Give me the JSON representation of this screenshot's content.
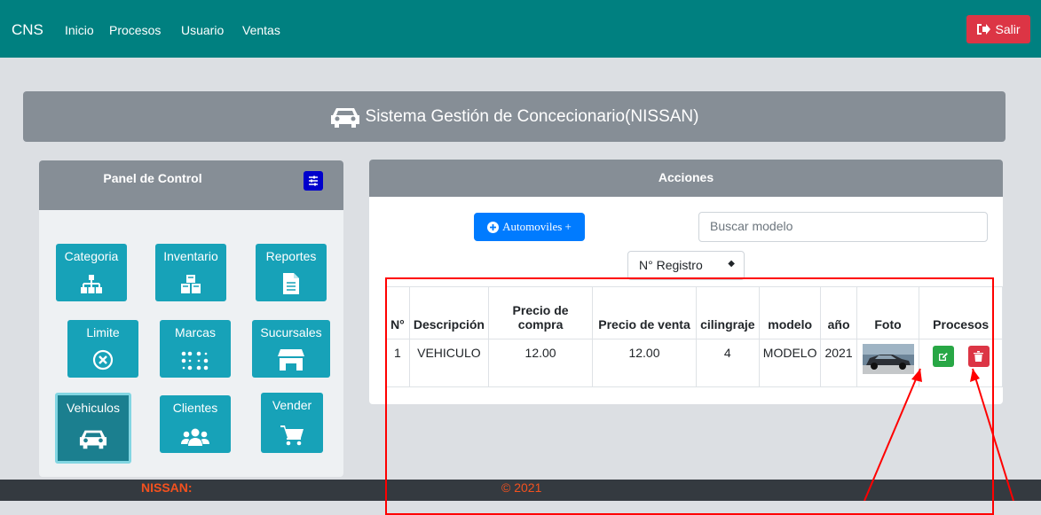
{
  "navbar": {
    "brand": "CNS",
    "links": [
      "Inicio",
      "Procesos",
      "Usuario",
      "Ventas"
    ],
    "logout": "Salir"
  },
  "banner": {
    "title": "Sistema Gestión de Concecionario(NISSAN)",
    "icon": "car-icon"
  },
  "control_panel": {
    "title": "Panel de Control",
    "tiles": [
      {
        "label": "Categoria",
        "icon": "sitemap-icon"
      },
      {
        "label": "Inventario",
        "icon": "cubes-icon"
      },
      {
        "label": "Reportes",
        "icon": "file-icon"
      },
      {
        "label": "Limite",
        "icon": "circle-x-icon"
      },
      {
        "label": "Marcas",
        "icon": "braille-icon"
      },
      {
        "label": "Sucursales",
        "icon": "store-icon"
      },
      {
        "label": "Vehiculos",
        "icon": "car-icon",
        "active": true
      },
      {
        "label": "Clientes",
        "icon": "users-icon"
      },
      {
        "label": "Vender",
        "icon": "cart-icon"
      }
    ]
  },
  "actions": {
    "title": "Acciones",
    "add_button": "Automoviles +",
    "search_placeholder": "Buscar modelo",
    "select_value": "N° Registro",
    "table": {
      "headers": [
        "N°",
        "Descripción",
        "Precio de compra",
        "Precio de venta",
        "cilingraje",
        "modelo",
        "año",
        "Foto",
        "Procesos"
      ],
      "rows": [
        {
          "n": "1",
          "descripcion": "VEHICULO",
          "precio_compra": "12.00",
          "precio_venta": "12.00",
          "cilingraje": "4",
          "modelo": "MODELO",
          "anio": "2021"
        }
      ]
    }
  },
  "footer": {
    "left": "NISSAN:",
    "center": "© 2021"
  },
  "colors": {
    "navbar": "#008080",
    "tile": "#17a2b8",
    "edit": "#28a745",
    "delete": "#dc3545",
    "annotation": "#ff0000"
  }
}
